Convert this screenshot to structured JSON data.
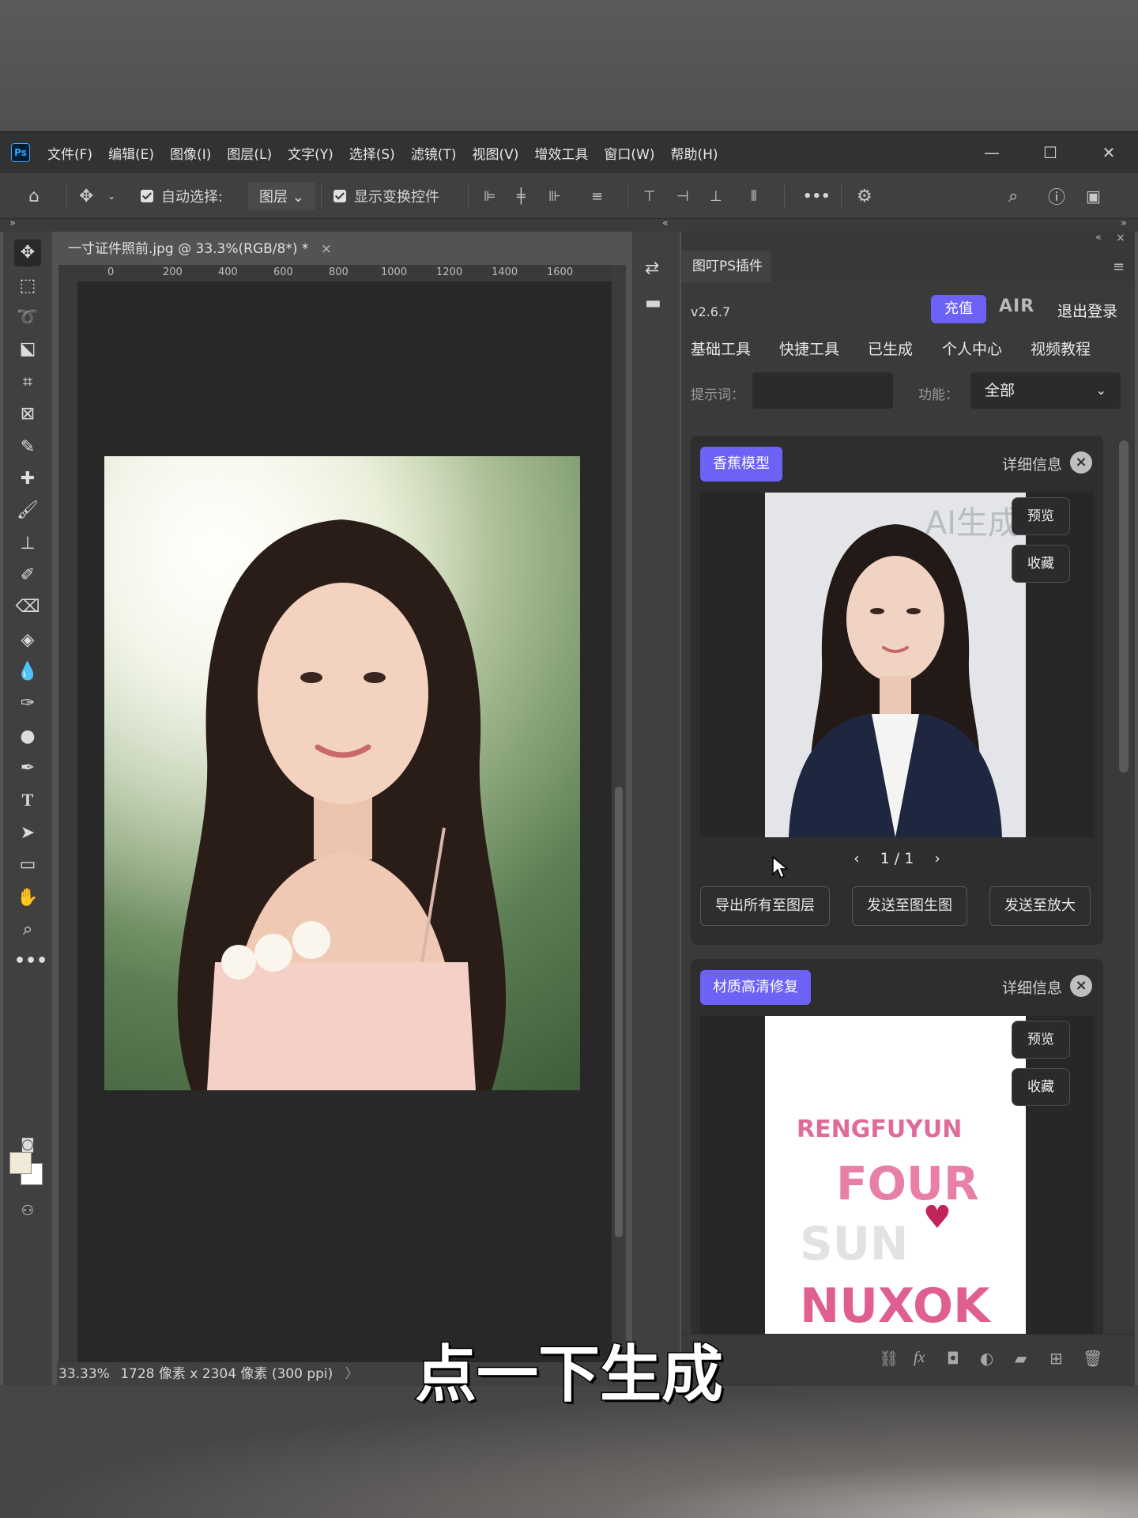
{
  "app": {
    "logo": "Ps",
    "menu": [
      "文件(F)",
      "编辑(E)",
      "图像(I)",
      "图层(L)",
      "文字(Y)",
      "选择(S)",
      "滤镜(T)",
      "视图(V)",
      "增效工具",
      "窗口(W)",
      "帮助(H)"
    ]
  },
  "options_bar": {
    "auto_select_label": "自动选择:",
    "auto_select_value": "图层",
    "show_transform_label": "显示变换控件",
    "more": "•••"
  },
  "document": {
    "tab_title": "一寸证件照前.jpg @ 33.3%(RGB/8*) *",
    "ruler_ticks": [
      "0",
      "200",
      "400",
      "600",
      "800",
      "1000",
      "1200",
      "1400",
      "1600"
    ],
    "status_zoom": "33.33%",
    "status_info": "1728 像素 x 2304 像素 (300 ppi)"
  },
  "plugin": {
    "tab_label": "图叮PS插件",
    "version": "v2.6.7",
    "recharge_label": "充值",
    "air_label": "AIR",
    "logout_label": "退出登录",
    "nav_tabs": [
      "基础工具",
      "快捷工具",
      "已生成",
      "个人中心",
      "视频教程"
    ],
    "active_tab": "已生成",
    "prompt_label": "提示词：",
    "prompt_value": "",
    "function_label": "功能：",
    "function_value": "全部",
    "cards": [
      {
        "badge": "香蕉模型",
        "detail_label": "详细信息",
        "watermark": "AI生成",
        "preview_label": "预览",
        "collect_label": "收藏",
        "pager_text": "1 / 1",
        "actions": [
          "导出所有至图层",
          "发送至图生图",
          "发送至放大"
        ]
      },
      {
        "badge": "材质高清修复",
        "detail_label": "详细信息",
        "preview_label": "预览",
        "collect_label": "收藏",
        "art_text": [
          "RENGFUYUN",
          "FOUR",
          "SUN",
          "NUXOK"
        ]
      }
    ]
  },
  "subtitle": "点一下生成",
  "colors": {
    "accent": "#6c62f5",
    "panel_bg": "#3a3a3a",
    "window_bg": "#535353"
  }
}
